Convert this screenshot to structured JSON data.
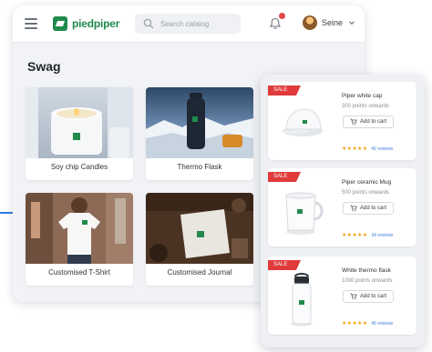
{
  "header": {
    "logo_text": "piedpiper",
    "search_placeholder": "Search catalog",
    "user_name": "Seine"
  },
  "page": {
    "title": "Swag"
  },
  "catalog": {
    "items": [
      {
        "label": "Soy chip Candles"
      },
      {
        "label": "Thermo Flask"
      },
      {
        "label": "Customised T-Shirt"
      },
      {
        "label": "Customised Journal"
      }
    ]
  },
  "panel": {
    "products": [
      {
        "tag": "SALE",
        "name": "Piper white cap",
        "points": "300 points onwards",
        "button": "Add to cart",
        "stars": "★★★★★",
        "reviews": "42 reviews"
      },
      {
        "tag": "SALE",
        "name": "Piper ceramic Mug",
        "points": "500 points onwards",
        "button": "Add to cart",
        "stars": "★★★★★",
        "reviews": "34 reviews"
      },
      {
        "tag": "SALE",
        "name": "White thermo flask",
        "points": "1000 points onwards",
        "button": "Add to cart",
        "stars": "★★★★★",
        "reviews": "45 reviews"
      }
    ]
  },
  "colors": {
    "brand_green": "#1f8a4c",
    "sale_red": "#e03a3a",
    "link_blue": "#3f7ed8",
    "star_gold": "#f0a31a"
  }
}
